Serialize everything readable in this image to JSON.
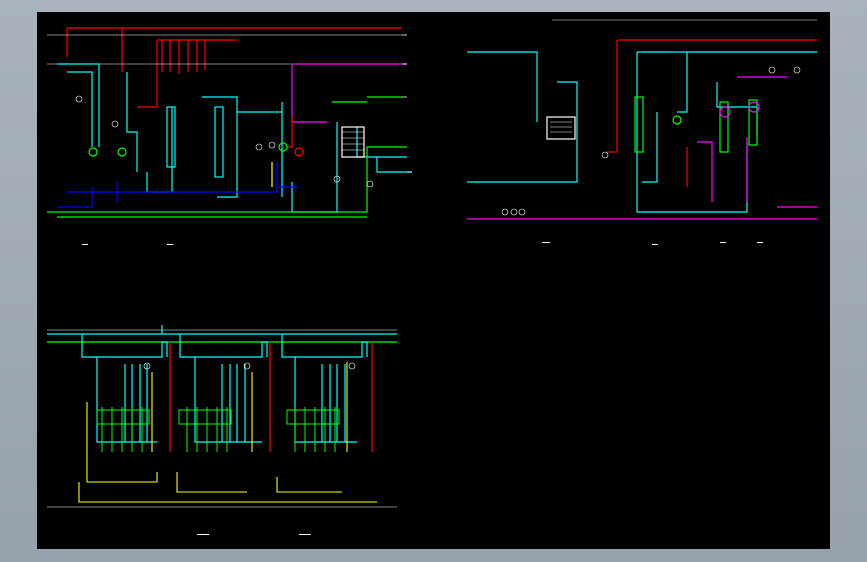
{
  "viewer": {
    "background_color": "#9aa3ae",
    "canvas_color": "#000000"
  },
  "line_colors": {
    "cyan": "#00ffff",
    "red": "#ff0000",
    "green": "#00ff00",
    "blue": "#0000ff",
    "magenta": "#ff00ff",
    "yellow": "#ffff00",
    "white": "#ffffff"
  },
  "sheets": [
    {
      "id": "sheet-top-left",
      "label": ""
    },
    {
      "id": "sheet-top-right",
      "label": ""
    },
    {
      "id": "sheet-bottom-left",
      "label": ""
    }
  ]
}
